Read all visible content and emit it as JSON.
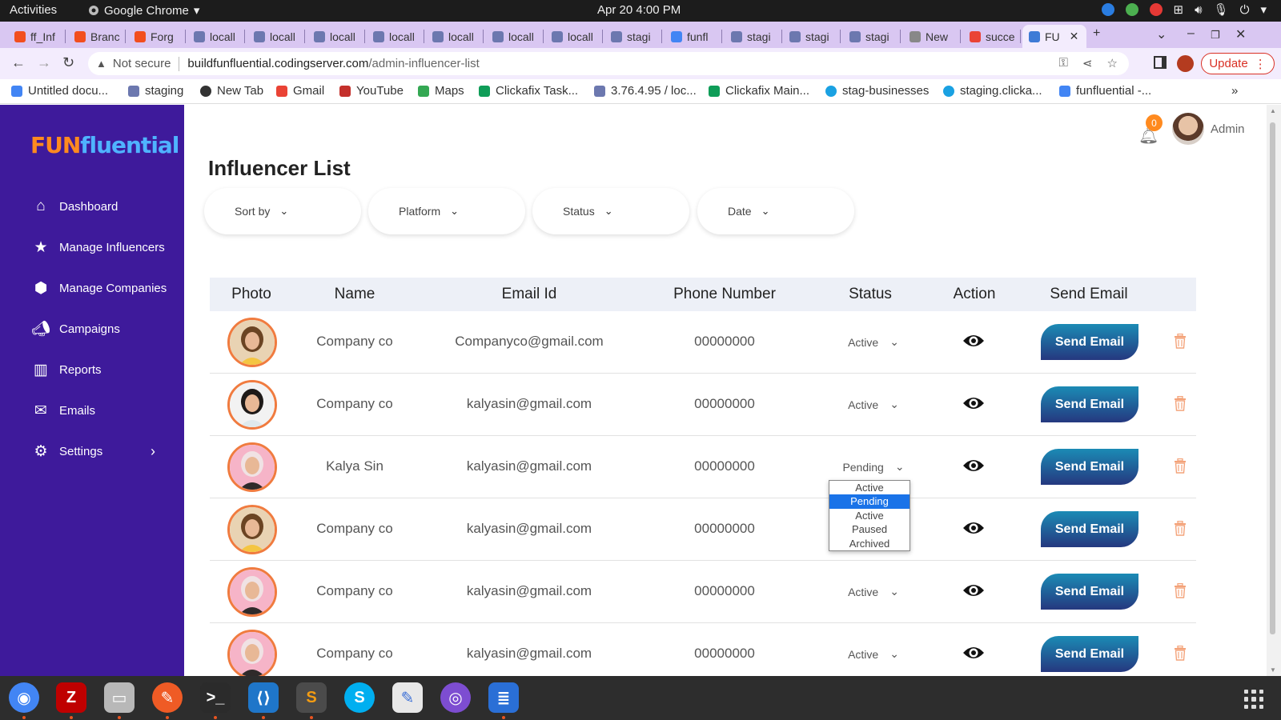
{
  "system": {
    "activities": "Activities",
    "app_name": "Google Chrome",
    "clock": "Apr 20  4:00 PM"
  },
  "tabs": [
    {
      "label": "ff_Inf",
      "icon": "figma-icon"
    },
    {
      "label": "Branc",
      "icon": "figma-icon"
    },
    {
      "label": "Forg",
      "icon": "figma-icon"
    },
    {
      "label": "locall",
      "icon": "phpmyadmin-icon"
    },
    {
      "label": "locall",
      "icon": "phpmyadmin-icon"
    },
    {
      "label": "locall",
      "icon": "phpmyadmin-icon"
    },
    {
      "label": "locall",
      "icon": "phpmyadmin-icon"
    },
    {
      "label": "locall",
      "icon": "phpmyadmin-icon"
    },
    {
      "label": "locall",
      "icon": "phpmyadmin-icon"
    },
    {
      "label": "locall",
      "icon": "phpmyadmin-icon"
    },
    {
      "label": "stagi",
      "icon": "phpmyadmin-icon"
    },
    {
      "label": "funfl",
      "icon": "docs-icon"
    },
    {
      "label": "stagi",
      "icon": "phpmyadmin-icon"
    },
    {
      "label": "stagi",
      "icon": "phpmyadmin-icon"
    },
    {
      "label": "stagi",
      "icon": "phpmyadmin-icon"
    },
    {
      "label": "New",
      "icon": "chrome-icon"
    },
    {
      "label": "succe",
      "icon": "google-icon"
    },
    {
      "label": "FU",
      "icon": "funfluential-icon",
      "active": true
    }
  ],
  "address": {
    "security": "Not secure",
    "host": "buildfunfluential.codingserver.com",
    "path": "/admin-influencer-list",
    "update_label": "Update"
  },
  "bookmarks": [
    {
      "label": "Untitled docu...",
      "icon": "docs-icon"
    },
    {
      "label": "staging",
      "icon": "phpmyadmin-icon"
    },
    {
      "label": "New Tab",
      "icon": "globe-icon"
    },
    {
      "label": "Gmail",
      "icon": "gmail-icon"
    },
    {
      "label": "YouTube",
      "icon": "youtube-icon"
    },
    {
      "label": "Maps",
      "icon": "maps-icon"
    },
    {
      "label": "Clickafix Task...",
      "icon": "sheets-icon"
    },
    {
      "label": "3.76.4.95 / loc...",
      "icon": "phpmyadmin-icon"
    },
    {
      "label": "Clickafix Main...",
      "icon": "sheets-icon"
    },
    {
      "label": "stag-businesses",
      "icon": "clickafix-icon"
    },
    {
      "label": "staging.clicka...",
      "icon": "clickafix-icon"
    },
    {
      "label": "funfluential -...",
      "icon": "docs-icon"
    }
  ],
  "sidebar": {
    "logo_fun": "FUN",
    "logo_rest": "fluential",
    "items": [
      {
        "label": "Dashboard",
        "icon": "home-icon"
      },
      {
        "label": "Manage Influencers",
        "icon": "star-icon"
      },
      {
        "label": "Manage Companies",
        "icon": "cube-icon"
      },
      {
        "label": "Campaigns",
        "icon": "megaphone-icon"
      },
      {
        "label": "Reports",
        "icon": "bar-chart-icon"
      },
      {
        "label": "Emails",
        "icon": "envelope-icon"
      },
      {
        "label": "Settings",
        "icon": "gear-icon"
      }
    ]
  },
  "header": {
    "notification_count": "0",
    "user": "Admin"
  },
  "page": {
    "title": "Influencer List",
    "filters": [
      "Sort by",
      "Platform",
      "Status",
      "Date"
    ]
  },
  "table": {
    "columns": [
      "Photo",
      "Name",
      "Email Id",
      "Phone Number",
      "Status",
      "Action",
      "Send Email"
    ],
    "send_label": "Send Email",
    "rows": [
      {
        "name": "Company co",
        "email": "Companyco@gmail.com",
        "phone": "00000000",
        "status": "Active",
        "photo": "curly"
      },
      {
        "name": "Company co",
        "email": "kalyasin@gmail.com",
        "phone": "00000000",
        "status": "Active",
        "photo": "dark"
      },
      {
        "name": "Kalya Sin",
        "email": "kalyasin@gmail.com",
        "phone": "00000000",
        "status": "Pending",
        "photo": "pink"
      },
      {
        "name": "Company co",
        "email": "kalyasin@gmail.com",
        "phone": "00000000",
        "status": "",
        "photo": "curly"
      },
      {
        "name": "Company co",
        "email": "kalyasin@gmail.com",
        "phone": "00000000",
        "status": "Active",
        "photo": "pink"
      },
      {
        "name": "Company co",
        "email": "kalyasin@gmail.com",
        "phone": "00000000",
        "status": "Active",
        "photo": "pink"
      }
    ]
  },
  "status_dropdown": {
    "options": [
      "Active",
      "Pending",
      "Active",
      "Paused",
      "Archived"
    ],
    "selected": "Pending"
  },
  "dock": [
    {
      "icon": "chrome-icon",
      "color": "#4285f4"
    },
    {
      "icon": "filezilla-icon",
      "color": "#bf0000"
    },
    {
      "icon": "files-icon",
      "color": "#b8b8b8"
    },
    {
      "icon": "postman-icon",
      "color": "#ef5b25"
    },
    {
      "icon": "terminal-icon",
      "color": "#2b2b2b"
    },
    {
      "icon": "vscode-icon",
      "color": "#1f76c9"
    },
    {
      "icon": "sublime-icon",
      "color": "#4b4b4b"
    },
    {
      "icon": "skype-icon",
      "color": "#00aff0"
    },
    {
      "icon": "text-editor-icon",
      "color": "#e8e8e8"
    },
    {
      "icon": "browser-icon",
      "color": "#7d4dd1"
    },
    {
      "icon": "document-viewer-icon",
      "color": "#2a6fd6"
    }
  ]
}
